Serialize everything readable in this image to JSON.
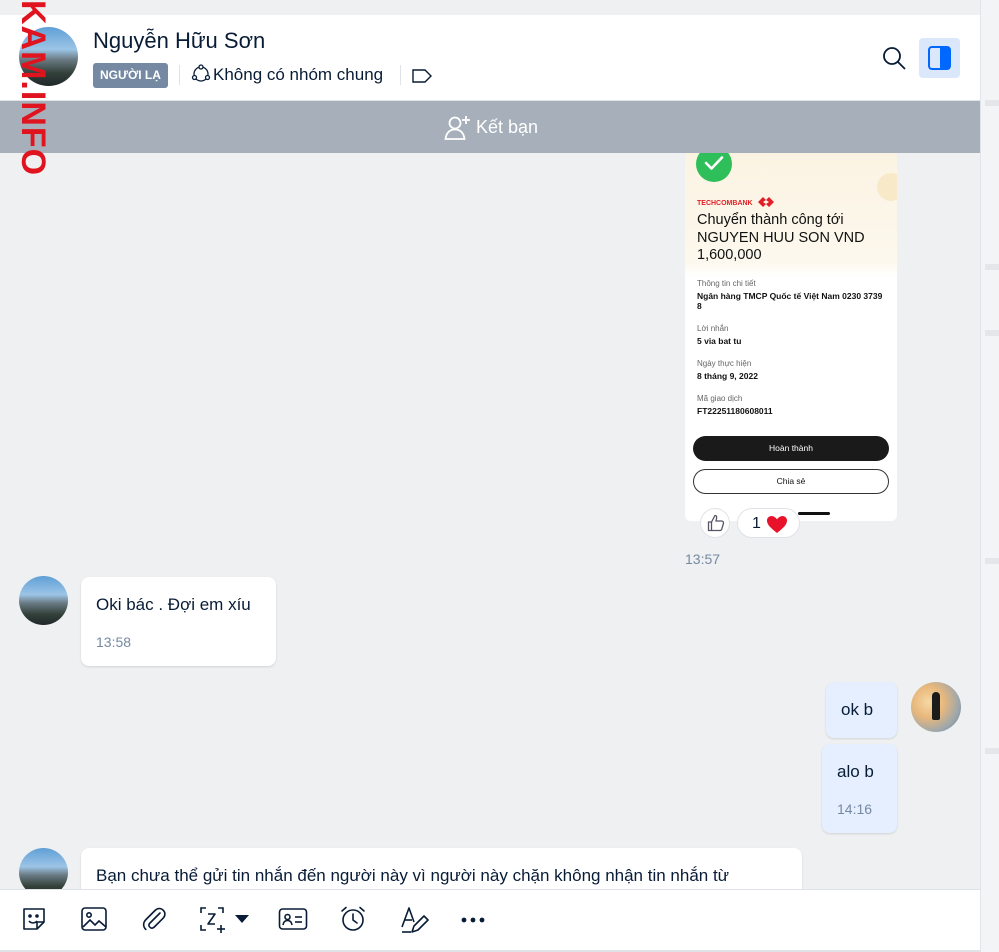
{
  "header": {
    "contact_name": "Nguyễn Hữu Sơn",
    "badge": "NGƯỜI LẠ",
    "groups_text": "Không có nhóm chung",
    "icons": [
      "user-avatar",
      "group-icon",
      "tag-icon",
      "search-icon",
      "panel-toggle-icon"
    ]
  },
  "add_friend": {
    "label": "Kết bạn",
    "icon": "add-user-icon"
  },
  "receipt": {
    "bank": "TECHCOMBANK",
    "title": "Chuyển thành công tới NGUYEN HUU SON VND 1,600,000",
    "details_label": "Thông tin chi tiết",
    "details_value": "Ngân hàng TMCP Quốc tế Việt Nam 0230 3739 8",
    "message_label": "Lời nhắn",
    "message_value": "5 via bat tu",
    "date_label": "Ngày thực hiện",
    "date_value": "8 tháng 9, 2022",
    "txn_label": "Mã giao dịch",
    "txn_value": "FT22251180608011",
    "done_button": "Hoàn thành",
    "share_button": "Chia sẻ"
  },
  "image_message": {
    "reaction_count": "1",
    "reaction": "heart",
    "timestamp": "13:57"
  },
  "messages": [
    {
      "from": "contact",
      "text": "Oki bác . Đợi em xíu",
      "time": "13:58"
    },
    {
      "from": "me",
      "text": "ok b",
      "time": ""
    },
    {
      "from": "me",
      "text": "alo b",
      "time": "14:16"
    },
    {
      "from": "contact",
      "text": "Bạn chưa thể gửi tin nhắn đến người này vì người này chặn không nhận tin nhắn từ",
      "time": ""
    }
  ],
  "composer": {
    "tools": [
      "sticker-icon",
      "image-icon",
      "attachment-icon",
      "screenshot-icon",
      "dropdown-icon",
      "contact-card-icon",
      "reminder-icon",
      "format-text-icon",
      "more-icon"
    ]
  },
  "watermark": "KAM.INFO",
  "colors": {
    "accent": "#0068ff",
    "badge_bg": "#7589a3",
    "add_friend_bar": "#a7b0ba",
    "my_bubble": "#e5efff",
    "heart": "#e8132b",
    "watermark": "#e0141e"
  }
}
